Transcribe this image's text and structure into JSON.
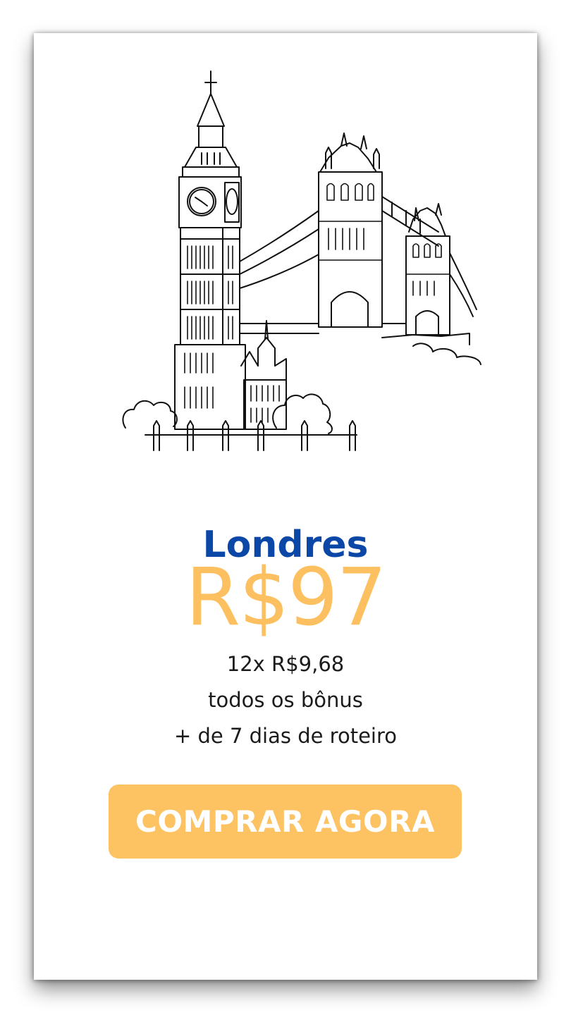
{
  "card": {
    "title": "Londres",
    "price": "R$97",
    "installments": "12x R$9,68",
    "bonus": "todos os bônus",
    "itinerary": "+ de 7 dias de roteiro",
    "cta_label": "COMPRAR AGORA"
  },
  "colors": {
    "title": "#0a47a6",
    "price": "#fcc060",
    "button": "#fdc262",
    "button_text": "#ffffff",
    "body_text": "#1b1b1b"
  },
  "illustration": {
    "icon": "london-landmarks-sketch-icon"
  }
}
